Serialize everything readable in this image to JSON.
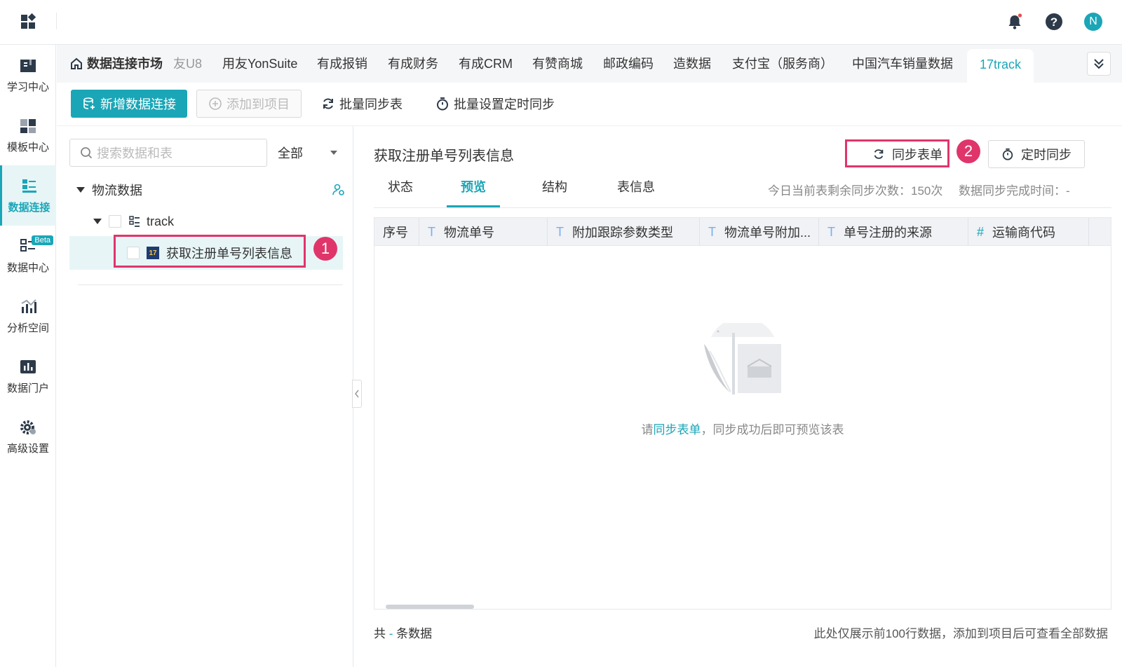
{
  "topbar": {
    "user_initial": "N"
  },
  "sidebar": {
    "items": [
      {
        "label": "学习中心",
        "icon": "book-icon"
      },
      {
        "label": "模板中心",
        "icon": "template-icon"
      },
      {
        "label": "数据连接",
        "icon": "data-connection-icon",
        "active": true
      },
      {
        "label": "数据中心",
        "icon": "data-center-icon",
        "badge": "Beta"
      },
      {
        "label": "分析空间",
        "icon": "analysis-icon"
      },
      {
        "label": "数据门户",
        "icon": "portal-icon"
      },
      {
        "label": "高级设置",
        "icon": "settings-icon"
      }
    ]
  },
  "tabs": {
    "home": "数据连接市场",
    "items": [
      "友U8",
      "用友YonSuite",
      "有成报销",
      "有成财务",
      "有成CRM",
      "有赞商城",
      "邮政编码",
      "造数据",
      "支付宝（服务商）",
      "中国汽车销量数据"
    ],
    "active": "17track"
  },
  "toolbar": {
    "new_connection": "新增数据连接",
    "add_to_project": "添加到项目",
    "batch_sync": "批量同步表",
    "batch_schedule": "批量设置定时同步"
  },
  "left": {
    "search_placeholder": "搜索数据和表",
    "filter": "全部",
    "tree": {
      "group": "物流数据",
      "connection": "track",
      "table": "获取注册单号列表信息",
      "table_icon_text": "17"
    },
    "badge1": "1"
  },
  "right": {
    "title": "获取注册单号列表信息",
    "sync_button": "同步表单",
    "schedule_button": "定时同步",
    "badge2": "2",
    "subtabs": [
      "状态",
      "预览",
      "结构",
      "表信息"
    ],
    "active_subtab": "预览",
    "remaining_label": "今日当前表剩余同步次数：150次",
    "complete_label": "数据同步完成时间：-",
    "columns": [
      {
        "name": "序号",
        "type": ""
      },
      {
        "name": "物流单号",
        "type": "T"
      },
      {
        "name": "附加跟踪参数类型",
        "type": "T"
      },
      {
        "name": "物流单号附加...",
        "type": "T"
      },
      {
        "name": "单号注册的来源",
        "type": "T"
      },
      {
        "name": "运输商代码",
        "type": "#"
      }
    ],
    "empty": {
      "prefix": "请",
      "link": "同步表单",
      "suffix": "，同步成功后即可预览该表"
    },
    "footer": {
      "total_prefix": "共",
      "total_value": "-",
      "total_suffix": "条数据",
      "note": "此处仅展示前100行数据，添加到项目后可查看全部数据"
    }
  },
  "colors": {
    "accent": "#1aa6b7",
    "highlight": "#e0356b",
    "notification_dot": "#e84a4a"
  }
}
